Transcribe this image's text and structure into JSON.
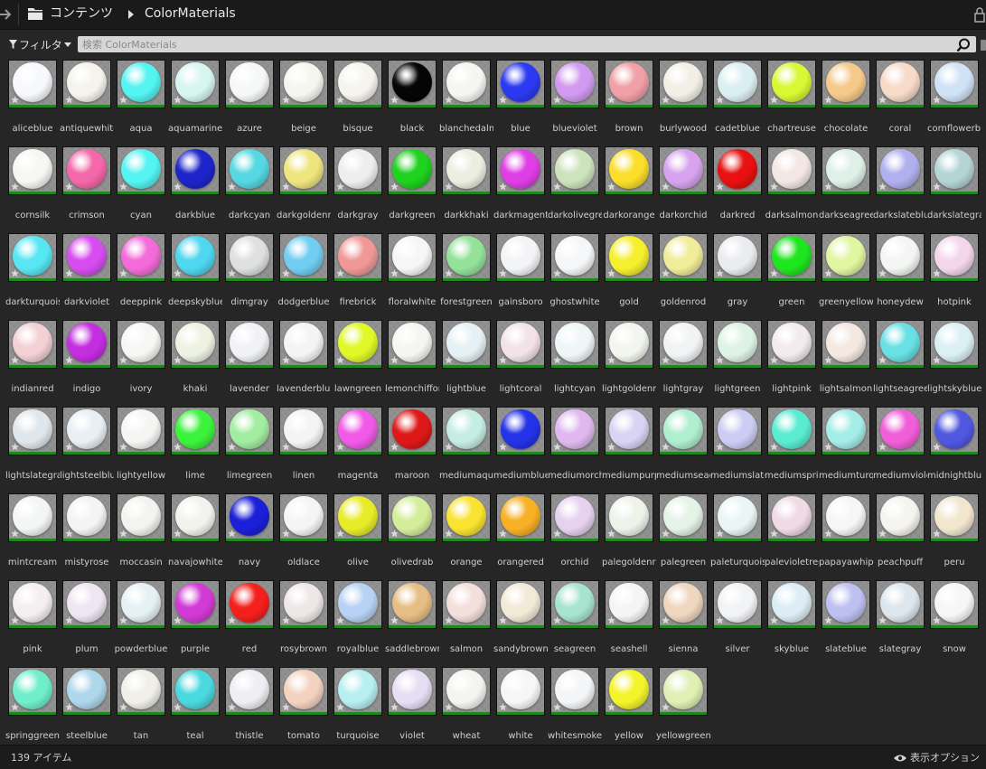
{
  "breadcrumb": {
    "root": "コンテンツ",
    "current": "ColorMaterials"
  },
  "filter": {
    "label": "フィルタ"
  },
  "search": {
    "placeholder": "検索 ColorMaterials",
    "value": ""
  },
  "accent": {
    "asset_bar": "#1e8a1e"
  },
  "assets": [
    {
      "name": "aliceblue",
      "color": "#f6f8fb"
    },
    {
      "name": "antiquewhite",
      "color": "#f6f3ee"
    },
    {
      "name": "aqua",
      "color": "#54f4f2"
    },
    {
      "name": "aquamarine",
      "color": "#d6f6ef"
    },
    {
      "name": "azure",
      "color": "#f6f8f8"
    },
    {
      "name": "beige",
      "color": "#f6f6f1"
    },
    {
      "name": "bisque",
      "color": "#f6f4ef"
    },
    {
      "name": "black",
      "color": "#050505"
    },
    {
      "name": "blanchedalmond",
      "color": "#f6f5f1"
    },
    {
      "name": "blue",
      "color": "#2b3af2"
    },
    {
      "name": "blueviolet",
      "color": "#d19af0"
    },
    {
      "name": "brown",
      "color": "#f0a0a6"
    },
    {
      "name": "burlywood",
      "color": "#f2efe6"
    },
    {
      "name": "cadetblue",
      "color": "#dbeff2"
    },
    {
      "name": "chartreuse",
      "color": "#d8f833"
    },
    {
      "name": "chocolate",
      "color": "#f5c98a"
    },
    {
      "name": "coral",
      "color": "#f7dac8"
    },
    {
      "name": "cornflowerblue",
      "color": "#cfe2f6"
    },
    {
      "name": "cornsilk",
      "color": "#f6f6f3"
    },
    {
      "name": "crimson",
      "color": "#f467a8"
    },
    {
      "name": "cyan",
      "color": "#54f4f2"
    },
    {
      "name": "darkblue",
      "color": "#1c24ca"
    },
    {
      "name": "darkcyan",
      "color": "#55d8e2"
    },
    {
      "name": "darkgoldenrod",
      "color": "#eee57e"
    },
    {
      "name": "darkgray",
      "color": "#eeeeef"
    },
    {
      "name": "darkgreen",
      "color": "#1ed21e"
    },
    {
      "name": "darkkhaki",
      "color": "#eceee0"
    },
    {
      "name": "darkmagenta",
      "color": "#df3ee6"
    },
    {
      "name": "darkolivegreen",
      "color": "#cde3bc"
    },
    {
      "name": "darkorange",
      "color": "#fbde2a"
    },
    {
      "name": "darkorchid",
      "color": "#d7a3ee"
    },
    {
      "name": "darkred",
      "color": "#e81010"
    },
    {
      "name": "darksalmon",
      "color": "#f2e7e2"
    },
    {
      "name": "darkseagreen",
      "color": "#dff0e8"
    },
    {
      "name": "darkslateblue",
      "color": "#b1b0ee"
    },
    {
      "name": "darkslategray",
      "color": "#b4d4d5"
    },
    {
      "name": "darkturquoise",
      "color": "#56e7f3"
    },
    {
      "name": "darkviolet",
      "color": "#d74cf0"
    },
    {
      "name": "deeppink",
      "color": "#f36bd8"
    },
    {
      "name": "deepskyblue",
      "color": "#4ed7ef"
    },
    {
      "name": "dimgray",
      "color": "#dfe0e1"
    },
    {
      "name": "dodgerblue",
      "color": "#71cdf2"
    },
    {
      "name": "firebrick",
      "color": "#f09898"
    },
    {
      "name": "floralwhite",
      "color": "#f6f6f6"
    },
    {
      "name": "forestgreen",
      "color": "#94e29a"
    },
    {
      "name": "gainsboro",
      "color": "#f3f4f6"
    },
    {
      "name": "ghostwhite",
      "color": "#f5f6f7"
    },
    {
      "name": "gold",
      "color": "#f6ef2e"
    },
    {
      "name": "goldenrod",
      "color": "#f1ec98"
    },
    {
      "name": "gray",
      "color": "#eaecef"
    },
    {
      "name": "green",
      "color": "#1ee61e"
    },
    {
      "name": "greenyellow",
      "color": "#e1f6a0"
    },
    {
      "name": "honeydew",
      "color": "#f4f6f4"
    },
    {
      "name": "hotpink",
      "color": "#f4d6ec"
    },
    {
      "name": "indianred",
      "color": "#f2d0d4"
    },
    {
      "name": "indigo",
      "color": "#c42ee0"
    },
    {
      "name": "ivory",
      "color": "#f6f6f4"
    },
    {
      "name": "khaki",
      "color": "#eef2e2"
    },
    {
      "name": "lavender",
      "color": "#f1f2f5"
    },
    {
      "name": "lavenderblush",
      "color": "#f4f4f5"
    },
    {
      "name": "lawngreen",
      "color": "#e0f828"
    },
    {
      "name": "lemonchiffon",
      "color": "#f5f6f2"
    },
    {
      "name": "lightblue",
      "color": "#e6f1f5"
    },
    {
      "name": "lightcoral",
      "color": "#f3e3e8"
    },
    {
      "name": "lightcyan",
      "color": "#eef6f7"
    },
    {
      "name": "lightgoldenrodyellow",
      "color": "#f3f5ef"
    },
    {
      "name": "lightgray",
      "color": "#f1f3f5"
    },
    {
      "name": "lightgreen",
      "color": "#dff3e5"
    },
    {
      "name": "lightpink",
      "color": "#f3eaee"
    },
    {
      "name": "lightsalmon",
      "color": "#f4e8e2"
    },
    {
      "name": "lightseagreen",
      "color": "#69e0e3"
    },
    {
      "name": "lightskyblue",
      "color": "#daf0f5"
    },
    {
      "name": "lightslategray",
      "color": "#e0e7ec"
    },
    {
      "name": "lightsteelblue",
      "color": "#e8eff5"
    },
    {
      "name": "lightyellow",
      "color": "#f5f6f4"
    },
    {
      "name": "lime",
      "color": "#3cf33c"
    },
    {
      "name": "limegreen",
      "color": "#a2eda2"
    },
    {
      "name": "linen",
      "color": "#f4f4f4"
    },
    {
      "name": "magenta",
      "color": "#f159e8"
    },
    {
      "name": "maroon",
      "color": "#de1818"
    },
    {
      "name": "mediumaquamarine",
      "color": "#c6ede3"
    },
    {
      "name": "mediumblue",
      "color": "#2432e8"
    },
    {
      "name": "mediumorchid",
      "color": "#e0b8ef"
    },
    {
      "name": "mediumpurple",
      "color": "#d8d4f3"
    },
    {
      "name": "mediumseagreen",
      "color": "#b0eed0"
    },
    {
      "name": "mediumslateblue",
      "color": "#cdccf4"
    },
    {
      "name": "mediumspringgreen",
      "color": "#5aecd2"
    },
    {
      "name": "mediumturquoise",
      "color": "#a4ede8"
    },
    {
      "name": "mediumvioletred",
      "color": "#f15ed8"
    },
    {
      "name": "midnightblue",
      "color": "#5058e0"
    },
    {
      "name": "mintcream",
      "color": "#f4f6f6"
    },
    {
      "name": "mistyrose",
      "color": "#f4f4f4"
    },
    {
      "name": "moccasin",
      "color": "#f3f3ef"
    },
    {
      "name": "navajowhite",
      "color": "#f3f3ee"
    },
    {
      "name": "navy",
      "color": "#1a20d8"
    },
    {
      "name": "oldlace",
      "color": "#f4f5f4"
    },
    {
      "name": "olive",
      "color": "#e8ec28"
    },
    {
      "name": "olivedrab",
      "color": "#d4ed9a"
    },
    {
      "name": "orange",
      "color": "#f8e330"
    },
    {
      "name": "orangered",
      "color": "#f8b024"
    },
    {
      "name": "orchid",
      "color": "#e6d2f0"
    },
    {
      "name": "palegoldenrod",
      "color": "#eef3ea"
    },
    {
      "name": "palegreen",
      "color": "#e3f3e5"
    },
    {
      "name": "paleturquoise",
      "color": "#eaf5f5"
    },
    {
      "name": "palevioletred",
      "color": "#f0dae6"
    },
    {
      "name": "papayawhip",
      "color": "#f5f6f5"
    },
    {
      "name": "peachpuff",
      "color": "#f5f4ef"
    },
    {
      "name": "peru",
      "color": "#f2e6cf"
    },
    {
      "name": "pink",
      "color": "#f4eef0"
    },
    {
      "name": "plum",
      "color": "#eee6f2"
    },
    {
      "name": "powderblue",
      "color": "#e6f1f5"
    },
    {
      "name": "purple",
      "color": "#d23ad6"
    },
    {
      "name": "red",
      "color": "#f4201c"
    },
    {
      "name": "rosybrown",
      "color": "#eee7e8"
    },
    {
      "name": "royalblue",
      "color": "#b7d2f4"
    },
    {
      "name": "saddlebrown",
      "color": "#e6bd84"
    },
    {
      "name": "salmon",
      "color": "#f3dfdc"
    },
    {
      "name": "sandybrown",
      "color": "#f3e9d8"
    },
    {
      "name": "seagreen",
      "color": "#a7e4cf"
    },
    {
      "name": "seashell",
      "color": "#f5f5f6"
    },
    {
      "name": "sienna",
      "color": "#efd6be"
    },
    {
      "name": "silver",
      "color": "#f2f3f5"
    },
    {
      "name": "skyblue",
      "color": "#dcedf5"
    },
    {
      "name": "slateblue",
      "color": "#bfc0f2"
    },
    {
      "name": "slategray",
      "color": "#dce6ec"
    },
    {
      "name": "snow",
      "color": "#f6f6f6"
    },
    {
      "name": "springgreen",
      "color": "#70eecc"
    },
    {
      "name": "steelblue",
      "color": "#aed7ec"
    },
    {
      "name": "tan",
      "color": "#f0efe8"
    },
    {
      "name": "teal",
      "color": "#4ad9df"
    },
    {
      "name": "thistle",
      "color": "#eeeef3"
    },
    {
      "name": "tomato",
      "color": "#f4d2c0"
    },
    {
      "name": "turquoise",
      "color": "#b7eef0"
    },
    {
      "name": "violet",
      "color": "#e6def5"
    },
    {
      "name": "wheat",
      "color": "#f4f4f1"
    },
    {
      "name": "white",
      "color": "#f6f6f7"
    },
    {
      "name": "whitesmoke",
      "color": "#f4f5f6"
    },
    {
      "name": "yellow",
      "color": "#f4f42a"
    },
    {
      "name": "yellowgreen",
      "color": "#e0f0b4"
    }
  ],
  "status": {
    "item_count": "139 アイテム",
    "view_options": "表示オプション"
  }
}
